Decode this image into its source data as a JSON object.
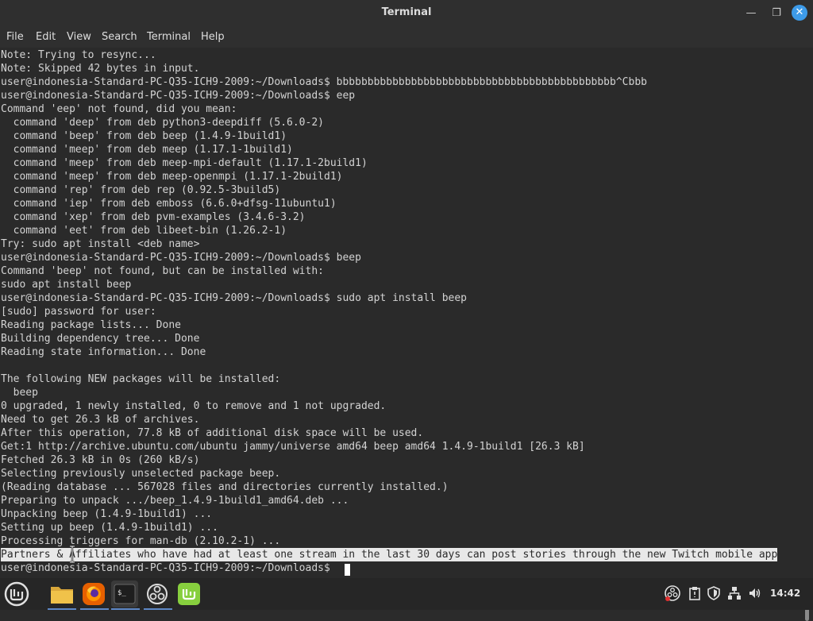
{
  "window": {
    "title": "Terminal",
    "min_glyph": "—",
    "max_glyph": "❐",
    "close_glyph": "✕"
  },
  "menu": [
    "File",
    "Edit",
    "View",
    "Search",
    "Terminal",
    "Help"
  ],
  "terminal": {
    "lines": [
      "Note: Trying to resync...",
      "Note: Skipped 42 bytes in input.",
      "user@indonesia-Standard-PC-Q35-ICH9-2009:~/Downloads$ bbbbbbbbbbbbbbbbbbbbbbbbbbbbbbbbbbbbbbbbbbbbb^Cbbb",
      "user@indonesia-Standard-PC-Q35-ICH9-2009:~/Downloads$ eep",
      "Command 'eep' not found, did you mean:",
      "  command 'deep' from deb python3-deepdiff (5.6.0-2)",
      "  command 'beep' from deb beep (1.4.9-1build1)",
      "  command 'meep' from deb meep (1.17.1-1build1)",
      "  command 'meep' from deb meep-mpi-default (1.17.1-2build1)",
      "  command 'meep' from deb meep-openmpi (1.17.1-2build1)",
      "  command 'rep' from deb rep (0.92.5-3build5)",
      "  command 'iep' from deb emboss (6.6.0+dfsg-11ubuntu1)",
      "  command 'xep' from deb pvm-examples (3.4.6-3.2)",
      "  command 'eet' from deb libeet-bin (1.26.2-1)",
      "Try: sudo apt install <deb name>",
      "user@indonesia-Standard-PC-Q35-ICH9-2009:~/Downloads$ beep",
      "Command 'beep' not found, but can be installed with:",
      "sudo apt install beep",
      "user@indonesia-Standard-PC-Q35-ICH9-2009:~/Downloads$ sudo apt install beep",
      "[sudo] password for user:",
      "Reading package lists... Done",
      "Building dependency tree... Done",
      "Reading state information... Done",
      "",
      "The following NEW packages will be installed:",
      "  beep",
      "0 upgraded, 1 newly installed, 0 to remove and 1 not upgraded.",
      "Need to get 26.3 kB of archives.",
      "After this operation, 77.8 kB of additional disk space will be used.",
      "Get:1 http://archive.ubuntu.com/ubuntu jammy/universe amd64 beep amd64 1.4.9-1build1 [26.3 kB]",
      "Fetched 26.3 kB in 0s (260 kB/s)",
      "Selecting previously unselected package beep.",
      "(Reading database ... 567028 files and directories currently installed.)",
      "Preparing to unpack .../beep_1.4.9-1build1_amd64.deb ...",
      "Unpacking beep (1.4.9-1build1) ...",
      "Setting up beep (1.4.9-1build1) ...",
      "Processing triggers for man-db (2.10.2-1) ...",
      "Partners & Affiliates who have had at least one stream in the last 30 days can post stories through the new Twitch mobile app",
      "user@indonesia-Standard-PC-Q35-ICH9-2009:~/Downloads$ "
    ],
    "highlighted_line_index": 37
  },
  "taskbar": {
    "apps": [
      {
        "name": "menu-button",
        "icon": "mint-logo-icon"
      },
      {
        "name": "files",
        "icon": "folder-icon"
      },
      {
        "name": "firefox",
        "icon": "firefox-icon"
      },
      {
        "name": "terminal",
        "icon": "terminal-icon"
      },
      {
        "name": "obs",
        "icon": "obs-icon"
      },
      {
        "name": "mintinstall",
        "icon": "mint-software-icon"
      }
    ],
    "terminal_glyph": "$_",
    "tray_icons": [
      "obs-tray-icon",
      "clipboard-icon",
      "shield-icon",
      "network-icon",
      "volume-icon"
    ],
    "clock": "14:42"
  },
  "colors": {
    "terminal_bg": "#2a2a2a",
    "text": "#d3d3d3",
    "accent_close": "#3d9be9",
    "mint_green": "#87cf3e",
    "firefox_orange": "#e66000",
    "folder_yellow": "#f0c24a"
  }
}
